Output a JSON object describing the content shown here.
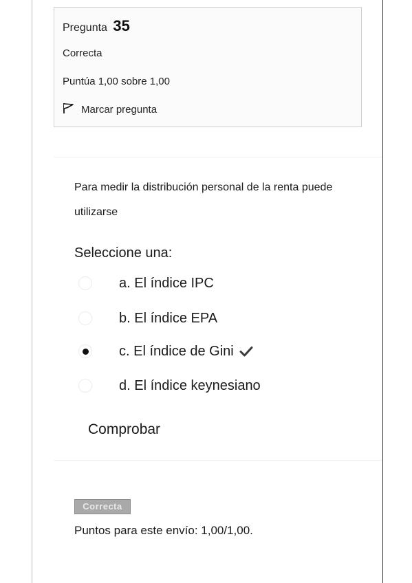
{
  "question_info": {
    "label": "Pregunta",
    "number": "35",
    "state": "Correcta",
    "grade": "Puntúa 1,00 sobre 1,00",
    "flag_label": "Marcar pregunta"
  },
  "question": {
    "text": "Para medir la distribución personal de la renta puede utilizarse",
    "prompt": "Seleccione una:",
    "options": [
      {
        "label": "a. El índice IPC",
        "selected": false,
        "correct": false
      },
      {
        "label": "b. El índice EPA",
        "selected": false,
        "correct": false
      },
      {
        "label": "c. El índice de Gini",
        "selected": true,
        "correct": true
      },
      {
        "label": "d. El índice keynesiano",
        "selected": false,
        "correct": false
      }
    ],
    "check_label": "Comprobar"
  },
  "feedback": {
    "badge": "Correcta",
    "points": "Puntos para este envío: 1,00/1,00."
  },
  "icons": {
    "flag": "flag-icon",
    "correct": "check-icon"
  },
  "colors": {
    "badge_bg": "#a9a9a9",
    "text": "#1a1a1a"
  }
}
